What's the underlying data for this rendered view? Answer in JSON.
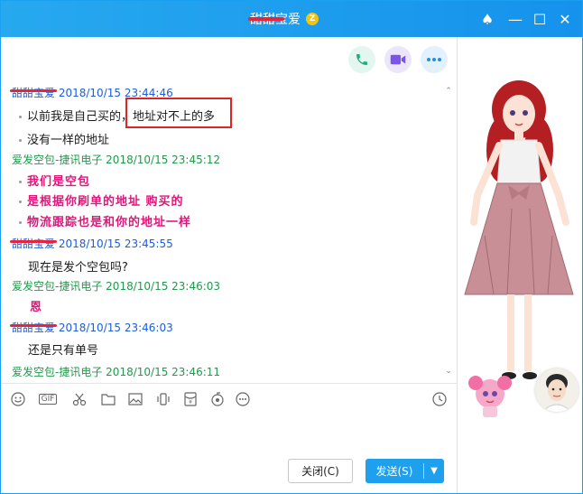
{
  "window": {
    "title": "甜甜宝爱",
    "vip_label": "Z",
    "controls": {
      "theme": "♠",
      "minimize": "—",
      "maximize": "☐",
      "close": "✕"
    }
  },
  "colors": {
    "accent": "#1fa0ee",
    "self_name": "#1a5ee0",
    "peer_name": "#1e9b4a",
    "pink_text": "#e0177a",
    "redact": "#e8233d"
  },
  "messages": [
    {
      "sender": "甜甜宝爱",
      "time": "2018/10/15 23:44:46",
      "side": "me",
      "lines": [
        "以前我是自己买的，地址对不上的多",
        "没有一样的地址"
      ]
    },
    {
      "sender": "爱发空包-捷讯电子",
      "time": "2018/10/15 23:45:12",
      "side": "them",
      "lines": [
        "我们是空包",
        "是根据你刷单的地址 购买的",
        "物流跟踪也是和你的地址一样"
      ]
    },
    {
      "sender": "甜甜宝爱",
      "time": "2018/10/15 23:45:55",
      "side": "me",
      "lines": [
        "现在是发个空包吗?"
      ]
    },
    {
      "sender": "爱发空包-捷讯电子",
      "time": "2018/10/15 23:46:03",
      "side": "them",
      "lines": [
        "恩"
      ]
    },
    {
      "sender": "甜甜宝爱",
      "time": "2018/10/15 23:46:03",
      "side": "me",
      "lines": [
        "还是只有单号"
      ]
    },
    {
      "sender": "爱发空包-捷讯电子",
      "time": "2018/10/15 23:46:11",
      "side": "them",
      "lines": []
    }
  ],
  "toolbar": {
    "icons": [
      "emoji-icon",
      "gif-icon",
      "scissors-icon",
      "folder-icon",
      "image-icon",
      "shake-icon",
      "red-packet-icon",
      "music-icon",
      "more-icon",
      "history-icon"
    ],
    "gif_label": "GIF"
  },
  "buttons": {
    "close": "关闭(C)",
    "send": "发送(S)"
  }
}
